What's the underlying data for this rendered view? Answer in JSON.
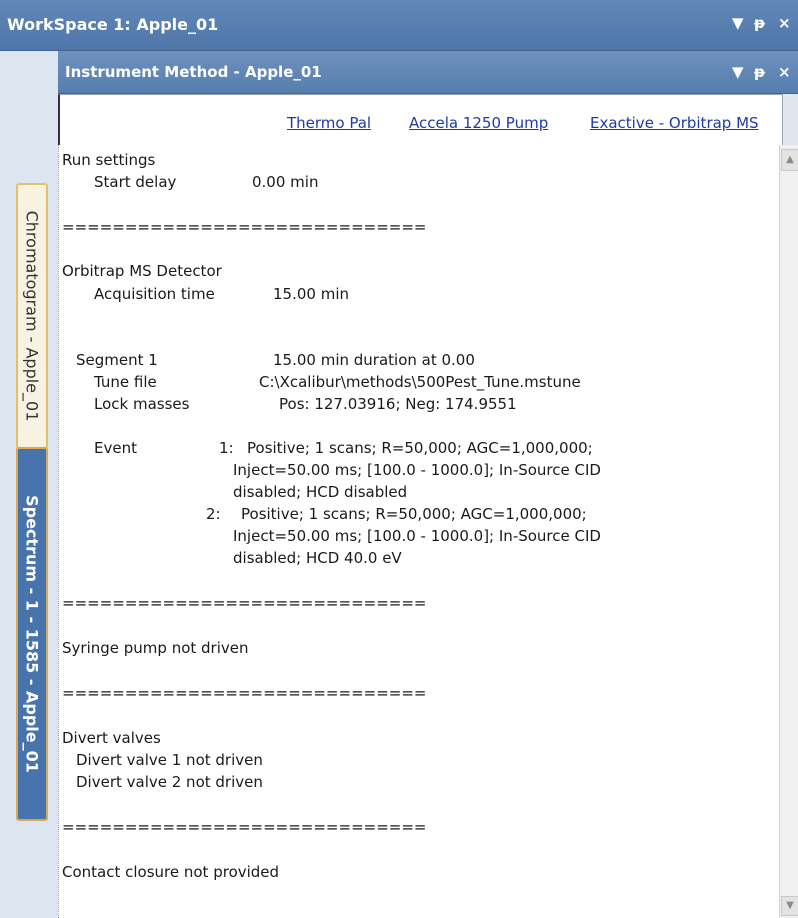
{
  "workspace": {
    "title": "WorkSpace 1: Apple_01",
    "controls": {
      "dropdown": "▼",
      "pin": "ᵽ",
      "close": "×"
    }
  },
  "side_tabs": [
    {
      "label": "Chromatogram - Apple_01",
      "active": false
    },
    {
      "label": "Spectrum - 1 - 1585 - Apple_01",
      "active": true
    }
  ],
  "method_window": {
    "title": "Instrument Method - Apple_01",
    "controls": {
      "dropdown": "▼",
      "pin": "ᵽ",
      "close": "×"
    }
  },
  "method_links": [
    "Thermo Pal",
    "Accela 1250 Pump",
    "Exactive - Orbitrap MS"
  ],
  "report": {
    "run_settings": "Run settings",
    "start_delay_label": "Start delay",
    "start_delay_value": "0.00 min",
    "sep": "=============================",
    "detector": "Orbitrap MS Detector",
    "acq_label": "Acquisition time",
    "acq_value": "15.00 min",
    "segment_label": "Segment 1",
    "segment_value": "15.00 min duration at 0.00",
    "tune_label": "Tune file",
    "tune_value": "C:\\Xcalibur\\methods\\500Pest_Tune.mstune",
    "lock_label": "Lock masses",
    "lock_value": "Pos: 127.03916; Neg: 174.9551",
    "event_label": "Event",
    "event1_num": "1:",
    "event1_l1": "Positive; 1 scans; R=50,000; AGC=1,000,000;",
    "event1_l2": "Inject=50.00 ms; [100.0 - 1000.0]; In-Source CID",
    "event1_l3": "disabled; HCD disabled",
    "event2_num": "2:",
    "event2_l1": "Positive; 1 scans; R=50,000; AGC=1,000,000;",
    "event2_l2": "Inject=50.00 ms; [100.0 - 1000.0]; In-Source CID",
    "event2_l3": "disabled; HCD 40.0 eV",
    "syringe": "Syringe pump not driven",
    "divert": "Divert valves",
    "divert1": "Divert valve 1 not driven",
    "divert2": "Divert valve 2 not driven",
    "contact": "Contact closure not provided"
  }
}
